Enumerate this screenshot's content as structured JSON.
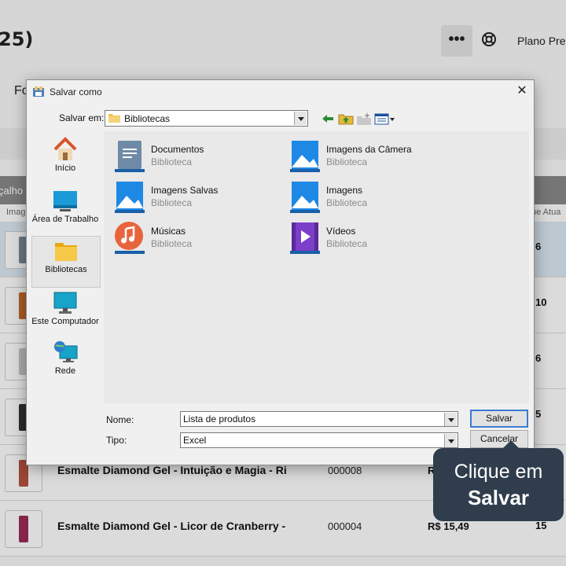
{
  "background": {
    "title_fragment": "25)",
    "more_label": "•••",
    "plan_label": "Plano Pre",
    "filter_fragment": "Fo",
    "header_left": "çalho",
    "header_right": "",
    "sub_left": "Imag",
    "sub_right": "ue Atua",
    "rows": [
      {
        "name": "",
        "code": "",
        "price": "",
        "qty": "6"
      },
      {
        "name": "",
        "code": "",
        "price": "",
        "qty": "10"
      },
      {
        "name": "",
        "code": "",
        "price": "",
        "qty": "6"
      },
      {
        "name": "",
        "code": "",
        "price": "",
        "qty": "5"
      },
      {
        "name": "Esmalte Diamond Gel - Intuição e Magia - Ri",
        "code": "000008",
        "price": "R",
        "qty": ""
      },
      {
        "name": "Esmalte Diamond Gel - Licor de Cranberry -",
        "code": "000004",
        "price": "R$ 15,49",
        "qty": "15"
      }
    ]
  },
  "dialog": {
    "title": "Salvar como",
    "close_label": "✕",
    "save_in_label": "Salvar em:",
    "save_in_value": "Bibliotecas",
    "places": [
      {
        "label": "Início",
        "icon": "home-icon"
      },
      {
        "label": "Área de Trabalho",
        "icon": "desktop-icon"
      },
      {
        "label": "Bibliotecas",
        "icon": "libraries-icon"
      },
      {
        "label": "Este Computador",
        "icon": "computer-icon"
      },
      {
        "label": "Rede",
        "icon": "network-icon"
      }
    ],
    "items": [
      {
        "name": "Documentos",
        "type": "Biblioteca",
        "icon": "documents-icon"
      },
      {
        "name": "Imagens da Câmera",
        "type": "Biblioteca",
        "icon": "pictures-icon"
      },
      {
        "name": "Imagens Salvas",
        "type": "Biblioteca",
        "icon": "pictures-icon"
      },
      {
        "name": "Imagens",
        "type": "Biblioteca",
        "icon": "pictures-icon"
      },
      {
        "name": "Músicas",
        "type": "Biblioteca",
        "icon": "music-icon"
      },
      {
        "name": "Vídeos",
        "type": "Biblioteca",
        "icon": "videos-icon"
      }
    ],
    "name_label": "Nome:",
    "name_value": "Lista de produtos",
    "type_label": "Tipo:",
    "type_value": "Excel",
    "save_button": "Salvar",
    "cancel_button": "Cancelar"
  },
  "tooltip": {
    "line1": "Clique em",
    "line2": "Salvar"
  },
  "colors": {
    "tooltip_bg": "#2f3d4c",
    "default_button_border": "#3a7bd5",
    "selected_row": "#dce9f4"
  }
}
